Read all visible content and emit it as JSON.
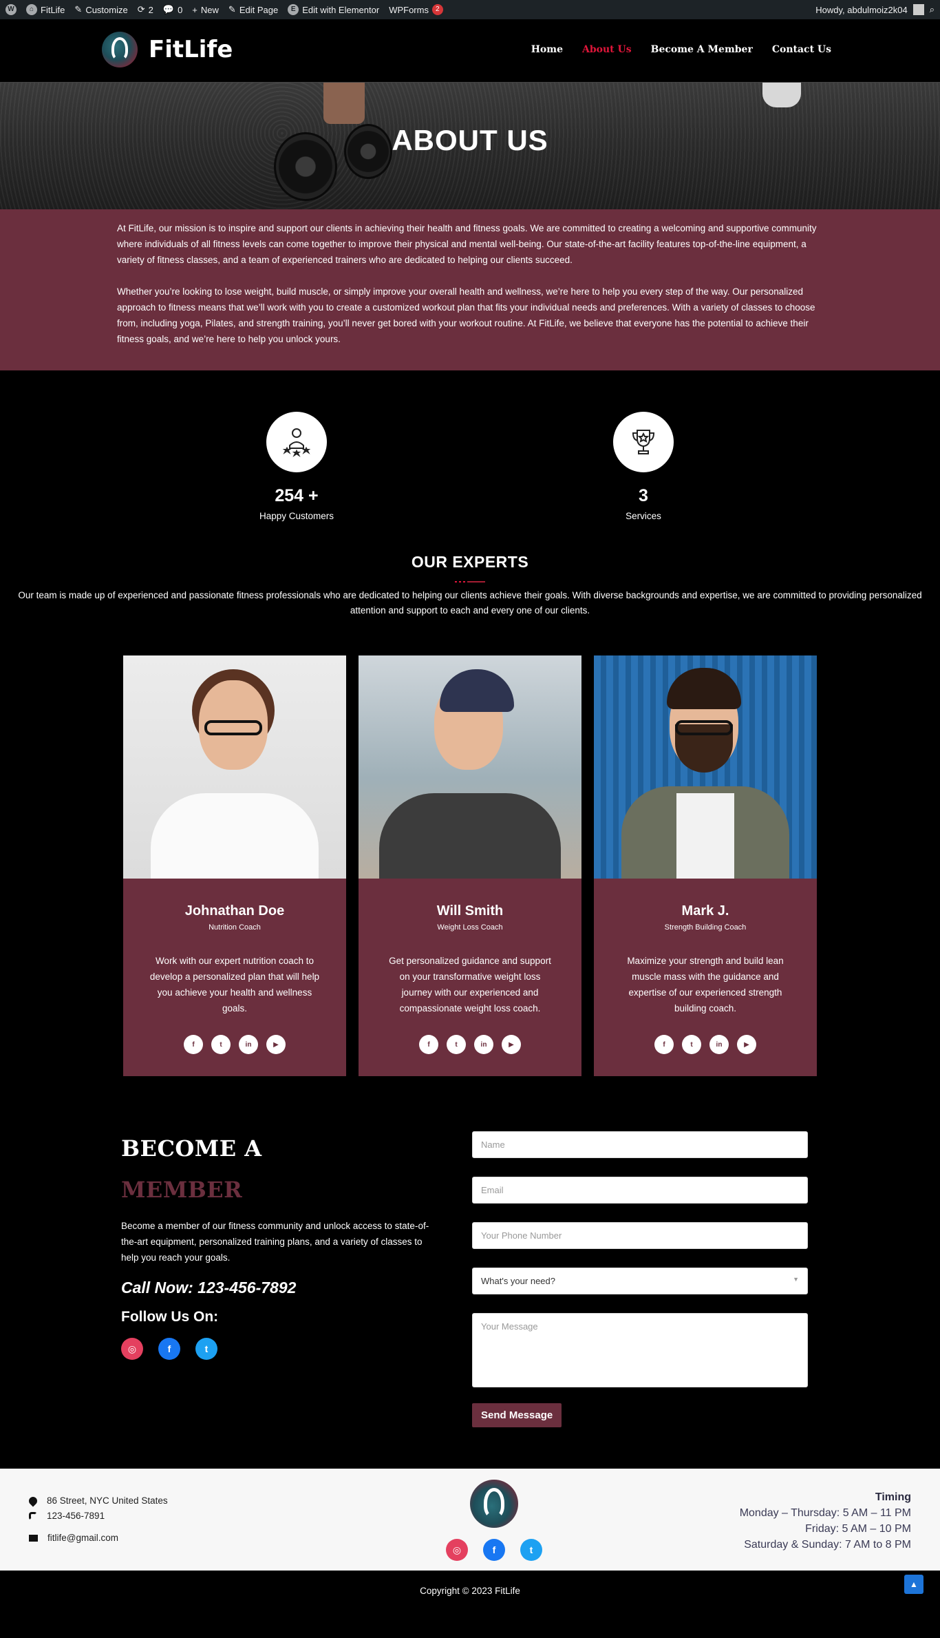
{
  "adminbar": {
    "site": "FitLife",
    "customize": "Customize",
    "updates": "2",
    "comments": "0",
    "new": "New",
    "edit_page": "Edit Page",
    "elementor": "Edit with Elementor",
    "wpforms": "WPForms",
    "wpforms_badge": "2",
    "howdy": "Howdy, abdulmoiz2k04"
  },
  "header": {
    "logo_text": "FitLife",
    "nav": [
      "Home",
      "About Us",
      "Become A Member",
      "Contact Us"
    ],
    "active": "About Us",
    "accent": "#e0163a"
  },
  "hero": {
    "title": "ABOUT US"
  },
  "about": {
    "p1": "At FitLife, our mission is to inspire and support our clients in achieving their health and fitness goals. We are committed to creating a welcoming and supportive community where individuals of all fitness levels can come together to improve their physical and mental well-being. Our state-of-the-art facility features top-of-the-line equipment, a variety of fitness classes, and a team of experienced trainers who are dedicated to helping our clients succeed.",
    "p2": "Whether you’re looking to lose weight, build muscle, or simply improve your overall health and wellness, we’re here to help you every step of the way. Our personalized approach to fitness means that we’ll work with you to create a customized workout plan that fits your individual needs and preferences. With a variety of classes to choose from, including yoga, Pilates, and strength training, you’ll never get bored with your workout routine. At FitLife, we believe that everyone has the potential to achieve their fitness goals, and we’re here to help you unlock yours.",
    "bg": "#6b2f3e"
  },
  "stats": [
    {
      "number": "254 +",
      "label": "Happy Customers",
      "icon": "customers-icon"
    },
    {
      "number": "3",
      "label": "Services",
      "icon": "trophy-icon"
    }
  ],
  "experts": {
    "title": "OUR EXPERTS",
    "intro": "Our team is made up of experienced and passionate fitness professionals who are dedicated to helping our clients achieve their goals. With diverse backgrounds and expertise, we are committed to providing personalized attention and support to each and every one of our clients.",
    "cards": [
      {
        "name": "Johnathan Doe",
        "role": "Nutrition Coach",
        "desc": "Work with our expert nutrition coach to develop a personalized plan that will help you achieve your health and wellness goals."
      },
      {
        "name": "Will Smith",
        "role": "Weight Loss Coach",
        "desc": "Get personalized guidance and support on your transformative weight loss journey with our experienced and compassionate weight loss coach."
      },
      {
        "name": "Mark J.",
        "role": "Strength Building Coach",
        "desc": "Maximize your strength and build lean muscle mass with the guidance and expertise of our experienced strength building coach."
      }
    ],
    "social_icons": [
      "f",
      "t",
      "in",
      "▶"
    ]
  },
  "member": {
    "title1": "BECOME A",
    "title2": "MEMBER",
    "text": "Become a member of our fitness community and unlock access to state-of-the-art equipment, personalized training plans, and a variety of classes to help you reach your goals.",
    "call": "Call Now: 123-456-7892",
    "follow": "Follow Us On:",
    "form": {
      "name_placeholder": "Name",
      "email_placeholder": "Email",
      "phone_placeholder": "Your Phone Number",
      "need_value": "What's your need?",
      "message_placeholder": "Your Message",
      "submit": "Send Message"
    }
  },
  "footer": {
    "address": "86 Street, NYC United States",
    "phone": "123-456-7891",
    "email": "fitlife@gmail.com",
    "timing_title": "Timing",
    "timing": [
      "Monday – Thursday: 5 AM – 11 PM",
      "Friday: 5 AM – 10 PM",
      "Saturday & Sunday: 7 AM to 8 PM"
    ],
    "copyright": "Copyright © 2023 FitLife"
  }
}
